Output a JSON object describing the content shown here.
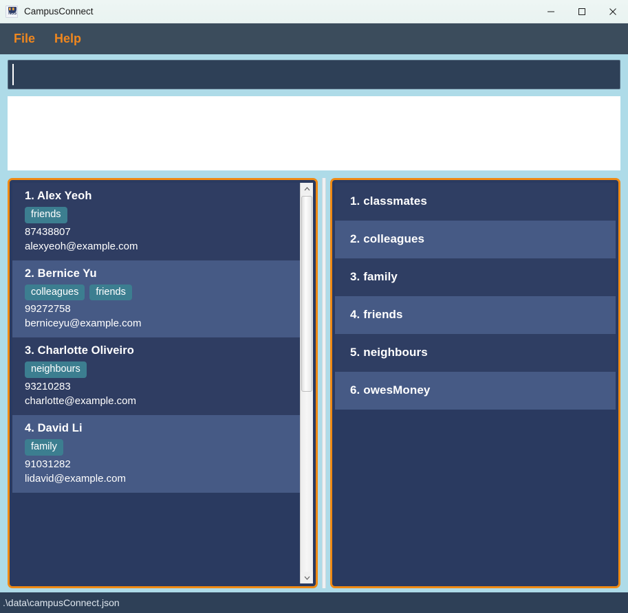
{
  "window": {
    "title": "CampusConnect",
    "icon": "nus-crest-icon",
    "controls": {
      "minimize": "minimize-icon",
      "maximize": "maximize-icon",
      "close": "close-icon"
    }
  },
  "menubar": {
    "items": [
      {
        "label": "File"
      },
      {
        "label": "Help"
      }
    ]
  },
  "command_box": {
    "value": "",
    "placeholder": ""
  },
  "result_display": {
    "text": ""
  },
  "person_list": {
    "scrollbar": {
      "up_arrow": "chevron-up-icon",
      "down_arrow": "chevron-down-icon"
    },
    "items": [
      {
        "index": "1.",
        "name": "Alex Yeoh",
        "tags": [
          "friends"
        ],
        "phone": "87438807",
        "email": "alexyeoh@example.com"
      },
      {
        "index": "2.",
        "name": "Bernice Yu",
        "tags": [
          "colleagues",
          "friends"
        ],
        "phone": "99272758",
        "email": "berniceyu@example.com"
      },
      {
        "index": "3.",
        "name": "Charlotte Oliveiro",
        "tags": [
          "neighbours"
        ],
        "phone": "93210283",
        "email": "charlotte@example.com"
      },
      {
        "index": "4.",
        "name": "David Li",
        "tags": [
          "family"
        ],
        "phone": "91031282",
        "email": "lidavid@example.com"
      }
    ]
  },
  "tag_list": {
    "items": [
      {
        "index": "1.",
        "label": "classmates"
      },
      {
        "index": "2.",
        "label": "colleagues"
      },
      {
        "index": "3.",
        "label": "family"
      },
      {
        "index": "4.",
        "label": "friends"
      },
      {
        "index": "5.",
        "label": "neighbours"
      },
      {
        "index": "6.",
        "label": "owesMoney"
      }
    ]
  },
  "statusbar": {
    "file_path": ".\\data\\campusConnect.json"
  },
  "colors": {
    "accent_orange": "#f08a14",
    "menu_text": "#f0871e",
    "window_bg": "#aedbe8",
    "panel_bg": "#2a3a60",
    "card_dark": "#2f3d62",
    "card_light": "#465a85",
    "tag_pill": "#3c7e90",
    "command_bg": "#2e4057",
    "menubar_bg": "#3b4c5c",
    "statusbar_bg": "#2e4057"
  }
}
